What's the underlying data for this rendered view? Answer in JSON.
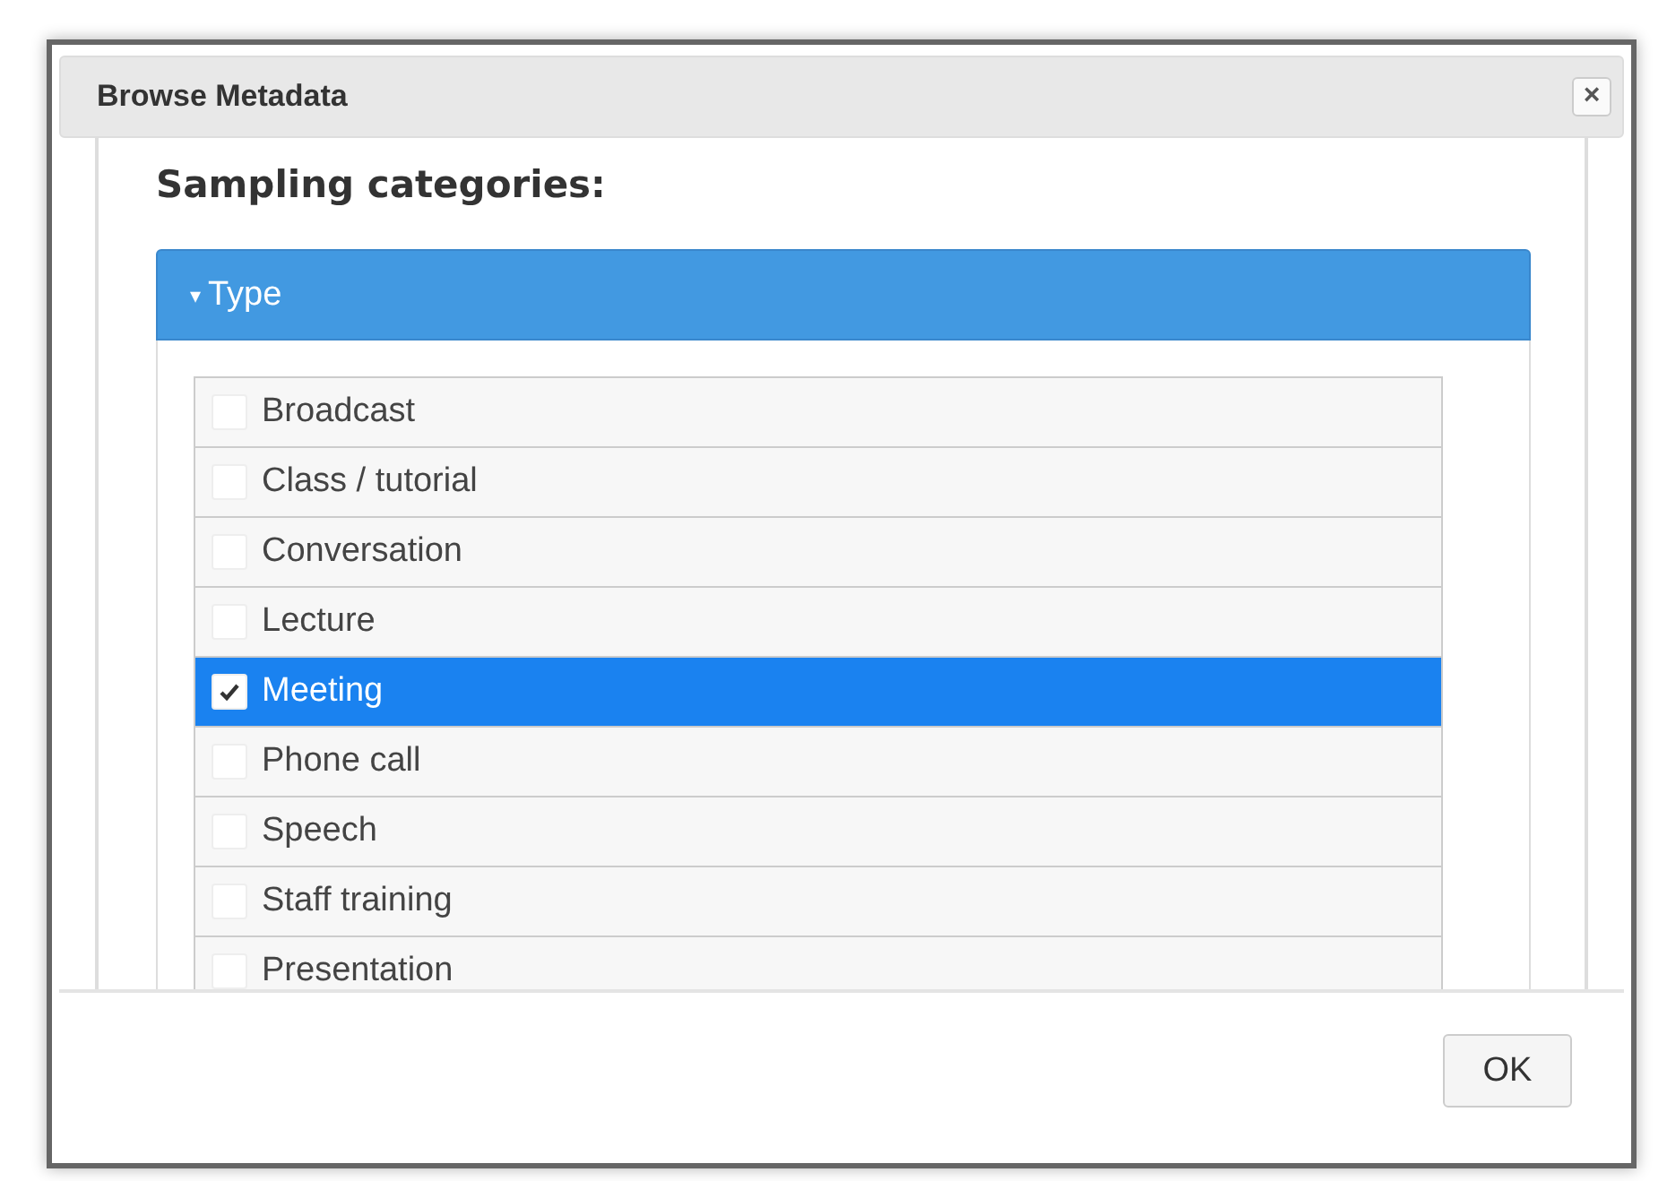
{
  "dialog": {
    "title": "Browse Metadata",
    "close": "×"
  },
  "heading": "Sampling categories:",
  "section": {
    "caret": "▾",
    "title": "Type",
    "expanded": true
  },
  "items": [
    {
      "label": "Broadcast",
      "checked": false,
      "selected": false
    },
    {
      "label": "Class / tutorial",
      "checked": false,
      "selected": false
    },
    {
      "label": "Conversation",
      "checked": false,
      "selected": false
    },
    {
      "label": "Lecture",
      "checked": false,
      "selected": false
    },
    {
      "label": "Meeting",
      "checked": true,
      "selected": true
    },
    {
      "label": "Phone call",
      "checked": false,
      "selected": false
    },
    {
      "label": "Speech",
      "checked": false,
      "selected": false
    },
    {
      "label": "Staff training",
      "checked": false,
      "selected": false
    },
    {
      "label": "Presentation",
      "checked": false,
      "selected": false
    }
  ],
  "buttons": [
    "OK"
  ]
}
